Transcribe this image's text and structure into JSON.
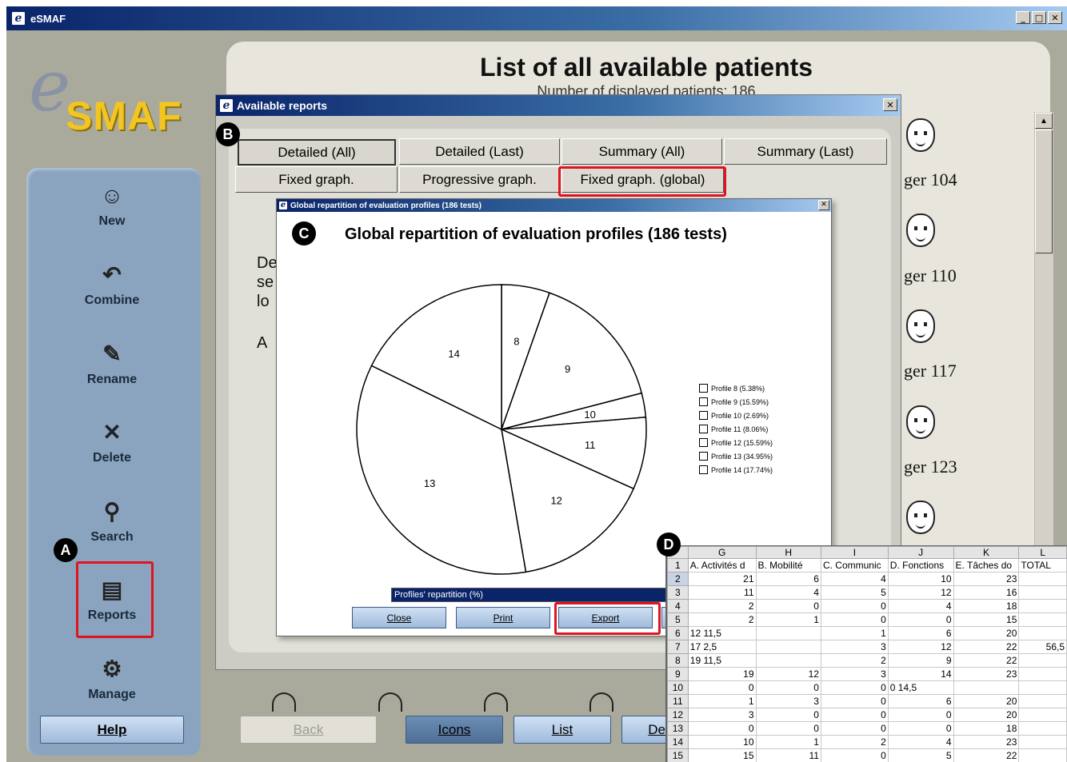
{
  "app": {
    "title": "eSMAF"
  },
  "logo": {
    "e": "e",
    "text": "SMAF"
  },
  "sidebar": {
    "items": [
      {
        "label": "New",
        "icon": "face-icon"
      },
      {
        "label": "Combine",
        "icon": "combine-arrow-icon"
      },
      {
        "label": "Rename",
        "icon": "pencil-icon"
      },
      {
        "label": "Delete",
        "icon": "delete-x-icon"
      },
      {
        "label": "Search",
        "icon": "magnifier-icon"
      },
      {
        "label": "Reports",
        "icon": "report-icon"
      },
      {
        "label": "Manage",
        "icon": "gears-icon"
      }
    ],
    "help_label": "Help"
  },
  "markers": {
    "a": "A",
    "b": "B",
    "c": "C",
    "d": "D"
  },
  "main": {
    "title": "List of all available patients",
    "subtitle": "Number of displayed patients: 186",
    "patients": [
      "ger 104",
      "ger 110",
      "ger 117",
      "ger 123"
    ],
    "bottom_buttons": {
      "back": "Back",
      "icons": "Icons",
      "list": "List",
      "de": "De"
    }
  },
  "reports_dialog": {
    "title": "Available reports",
    "tabs_row1": [
      "Detailed (All)",
      "Detailed (Last)",
      "Summary (All)",
      "Summary (Last)"
    ],
    "tabs_row2": [
      "Fixed graph.",
      "Progressive graph.",
      "Fixed graph. (global)"
    ],
    "partial_text": [
      "De",
      "se",
      "lo",
      "A"
    ]
  },
  "chart_dialog": {
    "window_title": "Global repartition of evaluation profiles (186 tests)",
    "selection_label": "Profiles' repartition (%)",
    "buttons": {
      "close": "Close",
      "print": "Print",
      "export": "Export"
    }
  },
  "chart_data": {
    "type": "pie",
    "title": "Global repartition of evaluation profiles (186 tests)",
    "slices": [
      {
        "label": "8",
        "legend": "Profile 8 (5.38%)",
        "percent": 5.38
      },
      {
        "label": "9",
        "legend": "Profile 9 (15.59%)",
        "percent": 15.59
      },
      {
        "label": "10",
        "legend": "Profile 10 (2.69%)",
        "percent": 2.69
      },
      {
        "label": "11",
        "legend": "Profile 11 (8.06%)",
        "percent": 8.06
      },
      {
        "label": "12",
        "legend": "Profile 12 (15.59%)",
        "percent": 15.59
      },
      {
        "label": "13",
        "legend": "Profile 13 (34.95%)",
        "percent": 34.95
      },
      {
        "label": "14",
        "legend": "Profile 14 (17.74%)",
        "percent": 17.74
      }
    ],
    "legend_position": "right"
  },
  "spreadsheet": {
    "columns": [
      "G",
      "H",
      "I",
      "J",
      "K",
      "L"
    ],
    "header_row": [
      "A. Activités d",
      "B. Mobilité",
      "C. Communic",
      "D. Fonctions",
      "E. Tâches do",
      "TOTAL"
    ],
    "rows": [
      [
        "2",
        "21",
        "6",
        "4",
        "10",
        "23",
        ""
      ],
      [
        "3",
        "11",
        "4",
        "5",
        "12",
        "16",
        ""
      ],
      [
        "4",
        "2",
        "0",
        "0",
        "4",
        "18",
        ""
      ],
      [
        "5",
        "2",
        "1",
        "0",
        "0",
        "15",
        ""
      ],
      [
        "6",
        "12 11,5",
        "",
        "1",
        "6",
        "20",
        ""
      ],
      [
        "7",
        "17 2,5",
        "",
        "3",
        "12",
        "22",
        "56,5"
      ],
      [
        "8",
        "19 11,5",
        "",
        "2",
        "9",
        "22",
        ""
      ],
      [
        "9",
        "19",
        "12",
        "3",
        "14",
        "23",
        ""
      ],
      [
        "10",
        "0",
        "0",
        "0",
        "0 14,5",
        "",
        ""
      ],
      [
        "11",
        "1",
        "3",
        "0",
        "6",
        "20",
        ""
      ],
      [
        "12",
        "3",
        "0",
        "0",
        "0",
        "20",
        ""
      ],
      [
        "13",
        "0",
        "0",
        "0",
        "0",
        "18",
        ""
      ],
      [
        "14",
        "10",
        "1",
        "2",
        "4",
        "23",
        ""
      ],
      [
        "15",
        "15",
        "11",
        "0",
        "5",
        "22",
        ""
      ]
    ]
  }
}
